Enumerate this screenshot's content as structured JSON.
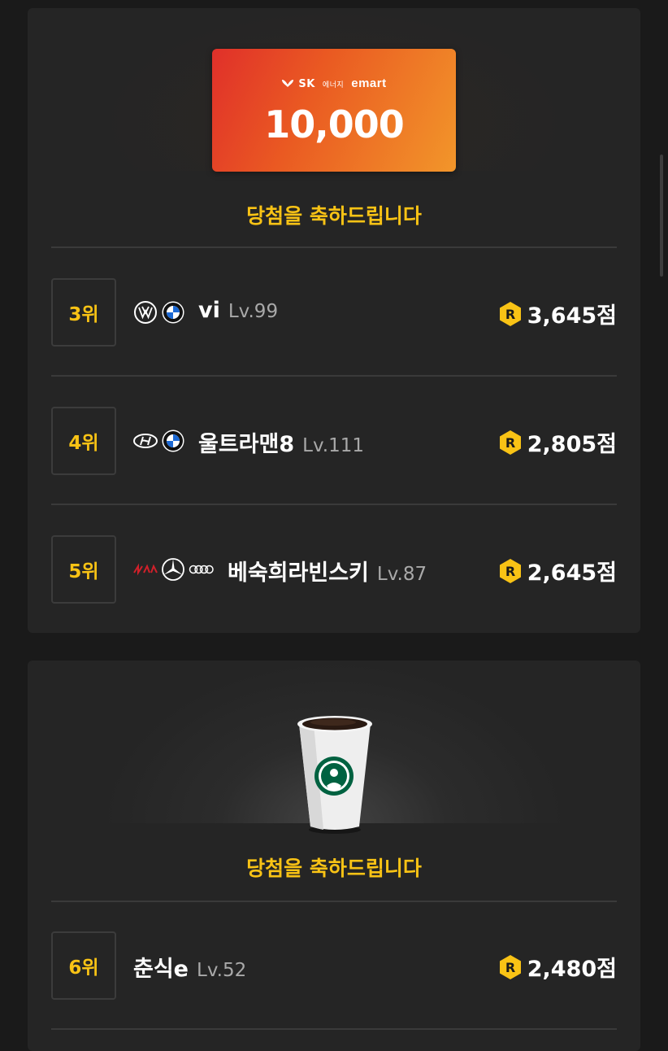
{
  "prize_sections": [
    {
      "prize": {
        "brand_sk": "SK",
        "brand_energy": "에너지",
        "brand_emart": "emart",
        "amount": "10,000",
        "gradient_colors": [
          "#e0302a",
          "#f2962a"
        ]
      },
      "congrats": "당첨을 축하드립니다",
      "rankings": [
        {
          "rank": "3위",
          "emblems": [
            "volkswagen-icon",
            "bmw-icon"
          ],
          "nickname": "vi",
          "level": "Lv.99",
          "score": "3,645점"
        },
        {
          "rank": "4위",
          "emblems": [
            "hyundai-icon",
            "bmw-icon"
          ],
          "nickname": "울트라맨8",
          "level": "Lv.111",
          "score": "2,805점"
        },
        {
          "rank": "5위",
          "emblems": [
            "kia-icon",
            "mercedes-icon",
            "audi-icon"
          ],
          "nickname": "베숙희라빈스키",
          "level": "Lv.87",
          "score": "2,645점"
        }
      ]
    },
    {
      "prize": {
        "image": "starbucks-coffee-cup-icon"
      },
      "congrats": "당첨을 축하드립니다",
      "rankings": [
        {
          "rank": "6위",
          "emblems": [],
          "nickname": "춘식e",
          "level": "Lv.52",
          "score": "2,480점"
        }
      ]
    }
  ],
  "colors": {
    "background": "#1a1a1a",
    "card": "#252525",
    "accent_yellow": "#f9c315",
    "level_gray": "#a9a9a9"
  }
}
